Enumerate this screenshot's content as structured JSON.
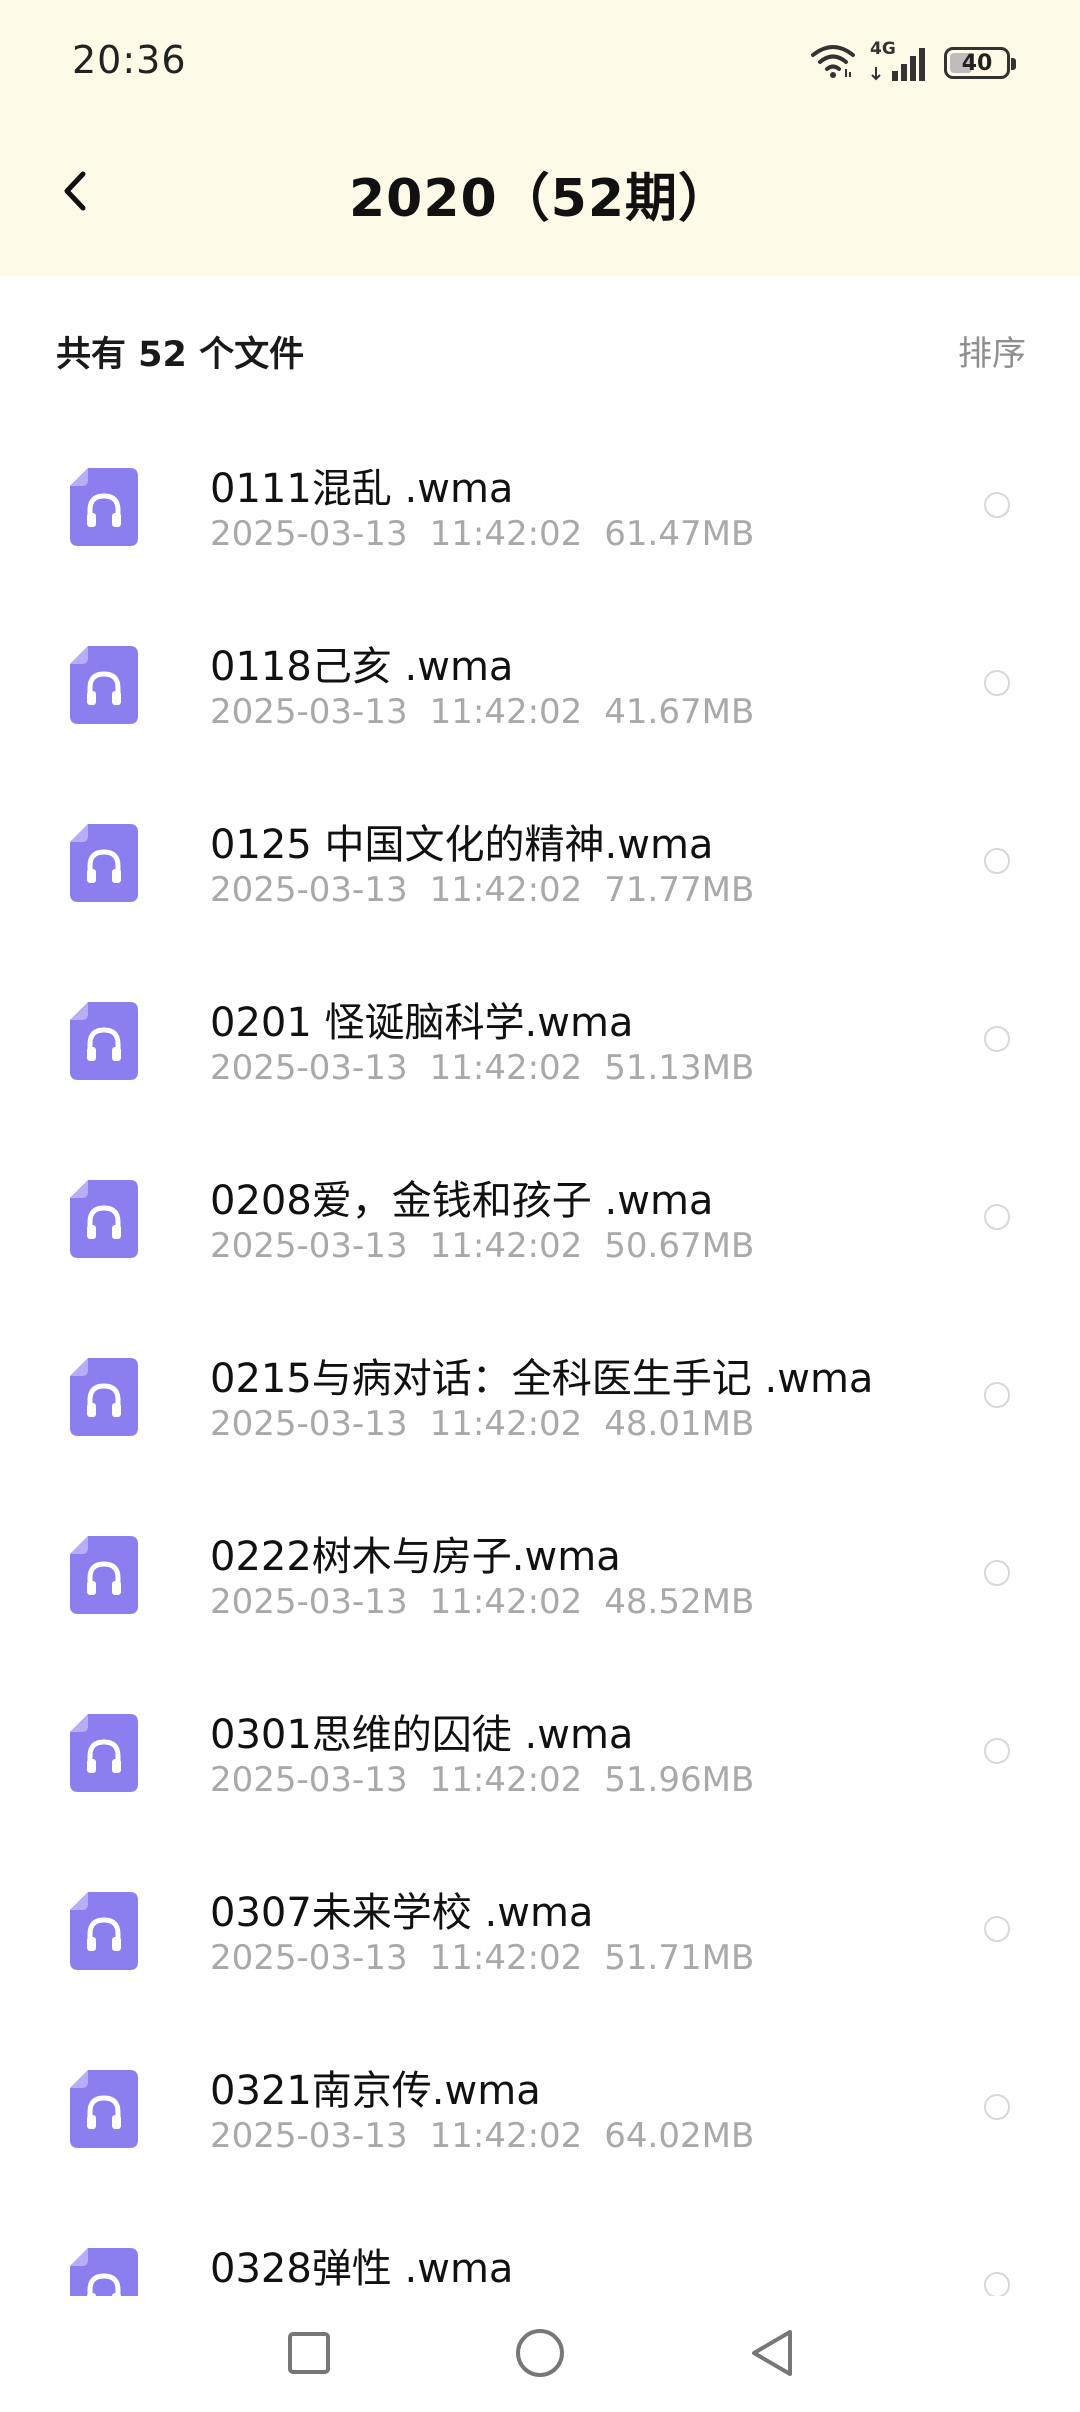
{
  "status_bar": {
    "time": "20:36",
    "network": "4G",
    "battery": "40",
    "battery_level": 0.4
  },
  "header": {
    "title": "2020（52期）",
    "back_icon": "chevron-left-icon"
  },
  "summary": {
    "file_count_label": "共有 52 个文件",
    "sort_label": "排序"
  },
  "colors": {
    "header_bg": "#fdfae7",
    "icon_accent": "#8b7ff0",
    "meta_text": "#a9a9a9"
  },
  "files": [
    {
      "name": "0111混乱 .wma",
      "date": "2025-03-13",
      "time": "11:42:02",
      "size": "61.47MB"
    },
    {
      "name": "0118己亥 .wma",
      "date": "2025-03-13",
      "time": "11:42:02",
      "size": "41.67MB"
    },
    {
      "name": "0125 中国文化的精神.wma",
      "date": "2025-03-13",
      "time": "11:42:02",
      "size": "71.77MB"
    },
    {
      "name": "0201 怪诞脑科学.wma",
      "date": "2025-03-13",
      "time": "11:42:02",
      "size": "51.13MB"
    },
    {
      "name": "0208爱，金钱和孩子 .wma",
      "date": "2025-03-13",
      "time": "11:42:02",
      "size": "50.67MB"
    },
    {
      "name": "0215与病对话：全科医生手记 .wma",
      "date": "2025-03-13",
      "time": "11:42:02",
      "size": "48.01MB"
    },
    {
      "name": "0222树木与房子.wma",
      "date": "2025-03-13",
      "time": "11:42:02",
      "size": "48.52MB"
    },
    {
      "name": "0301思维的囚徒 .wma",
      "date": "2025-03-13",
      "time": "11:42:02",
      "size": "51.96MB"
    },
    {
      "name": "0307未来学校 .wma",
      "date": "2025-03-13",
      "time": "11:42:02",
      "size": "51.71MB"
    },
    {
      "name": "0321南京传.wma",
      "date": "2025-03-13",
      "time": "11:42:02",
      "size": "64.02MB"
    },
    {
      "name": "0328弹性 .wma",
      "date": "",
      "time": "",
      "size": ""
    }
  ],
  "nav": {
    "recents_icon": "square-icon",
    "home_icon": "circle-icon",
    "back_icon": "triangle-back-icon"
  }
}
